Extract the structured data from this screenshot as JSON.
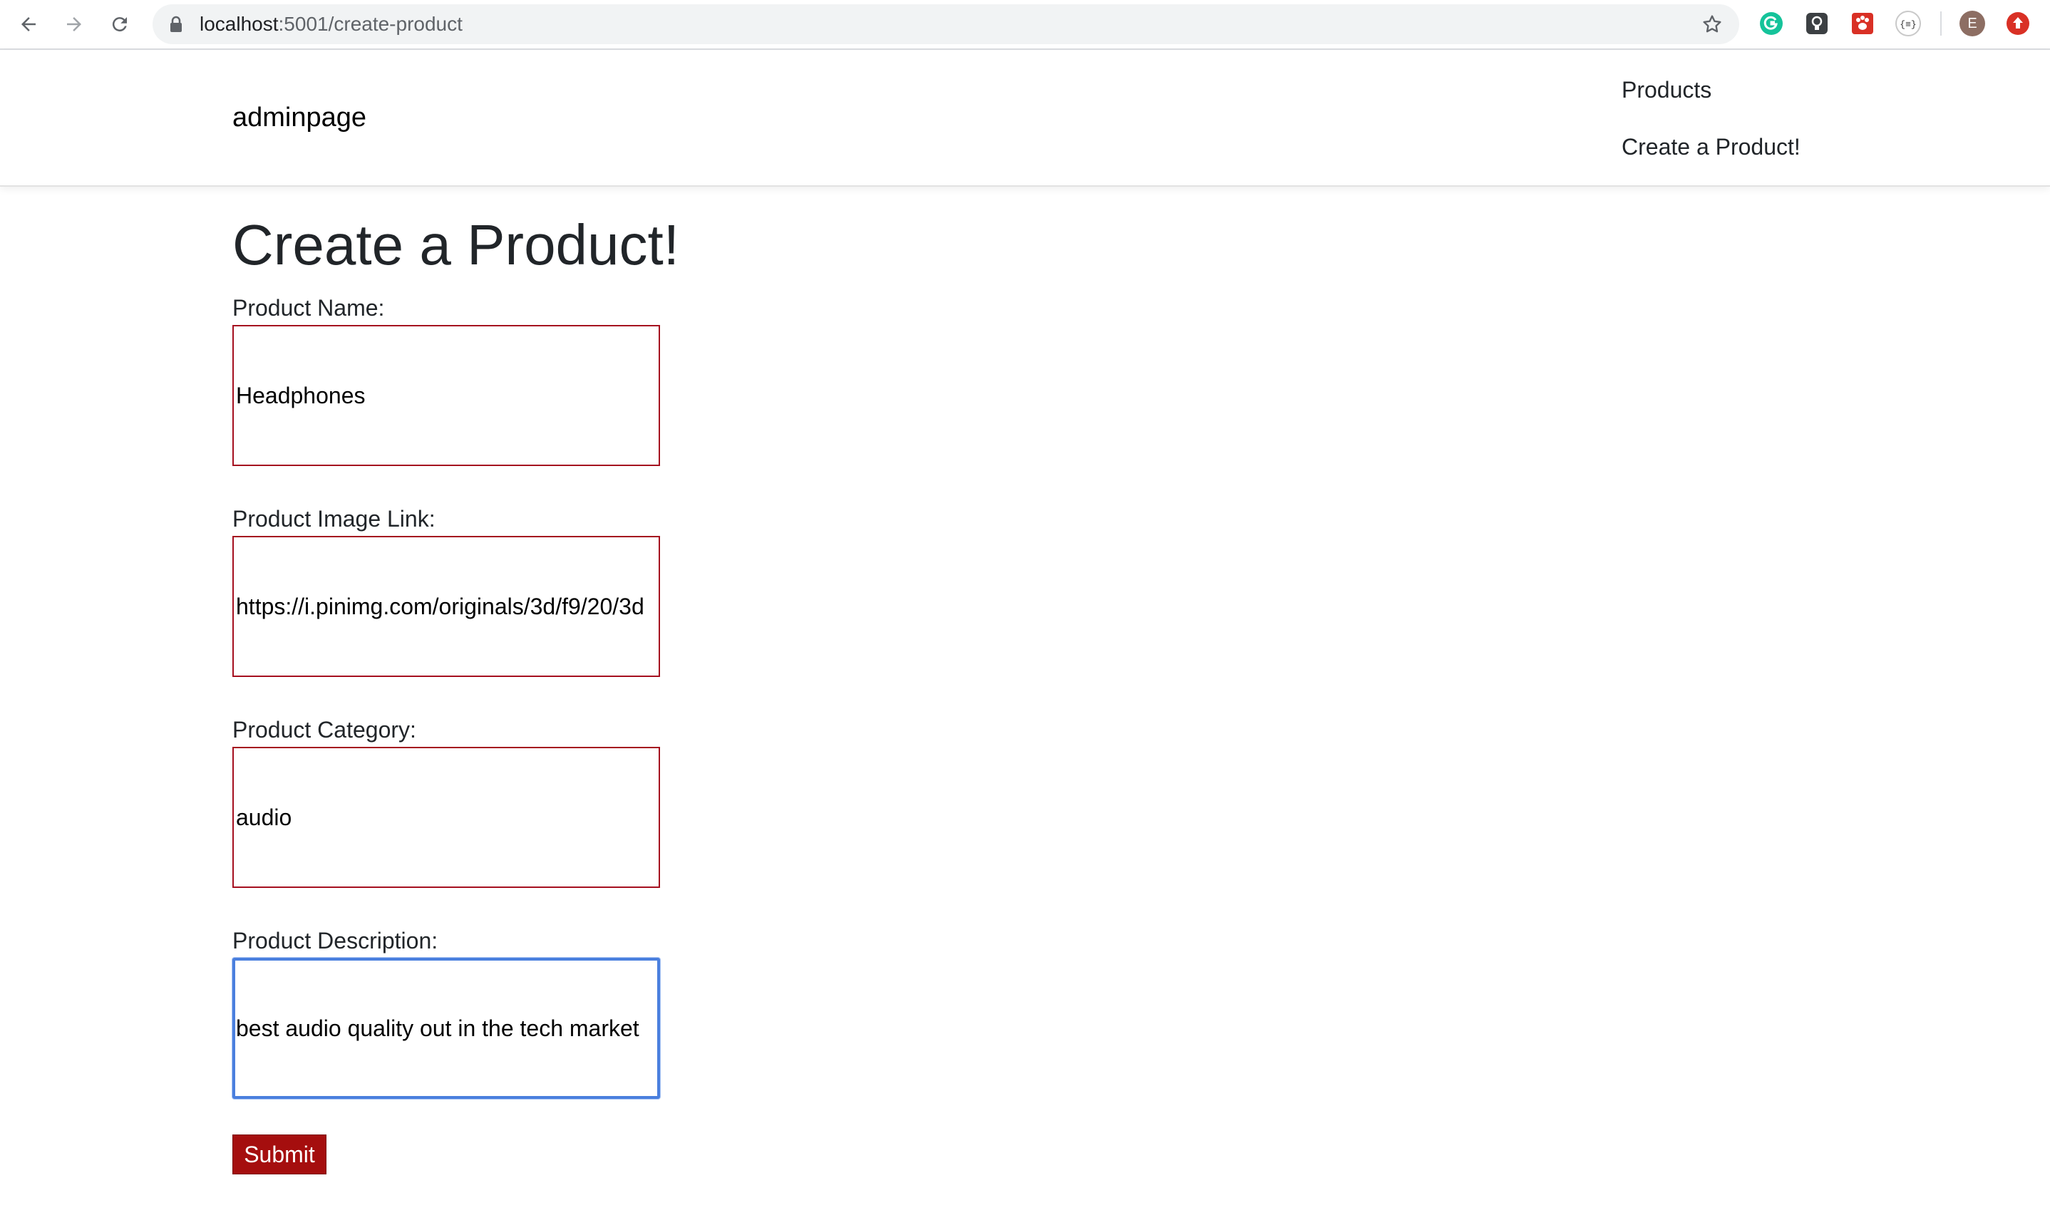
{
  "browser": {
    "url_host": "localhost",
    "url_path": ":5001/create-product",
    "profile_initial": "E"
  },
  "header": {
    "brand": "adminpage",
    "nav": [
      {
        "label": "Products"
      },
      {
        "label": "Create a Product!"
      }
    ]
  },
  "form": {
    "title": "Create a Product!",
    "fields": [
      {
        "label": "Product Name:",
        "value": "Headphones"
      },
      {
        "label": "Product Image Link:",
        "value": "https://i.pinimg.com/originals/3d/f9/20/3d"
      },
      {
        "label": "Product Category:",
        "value": "audio"
      },
      {
        "label": "Product Description:",
        "value": "best audio quality out in the tech market"
      }
    ],
    "submit_label": "Submit"
  },
  "colors": {
    "accent": "#a50e0e",
    "input_border": "#a50f1f",
    "focus_ring": "#4a7fde"
  }
}
